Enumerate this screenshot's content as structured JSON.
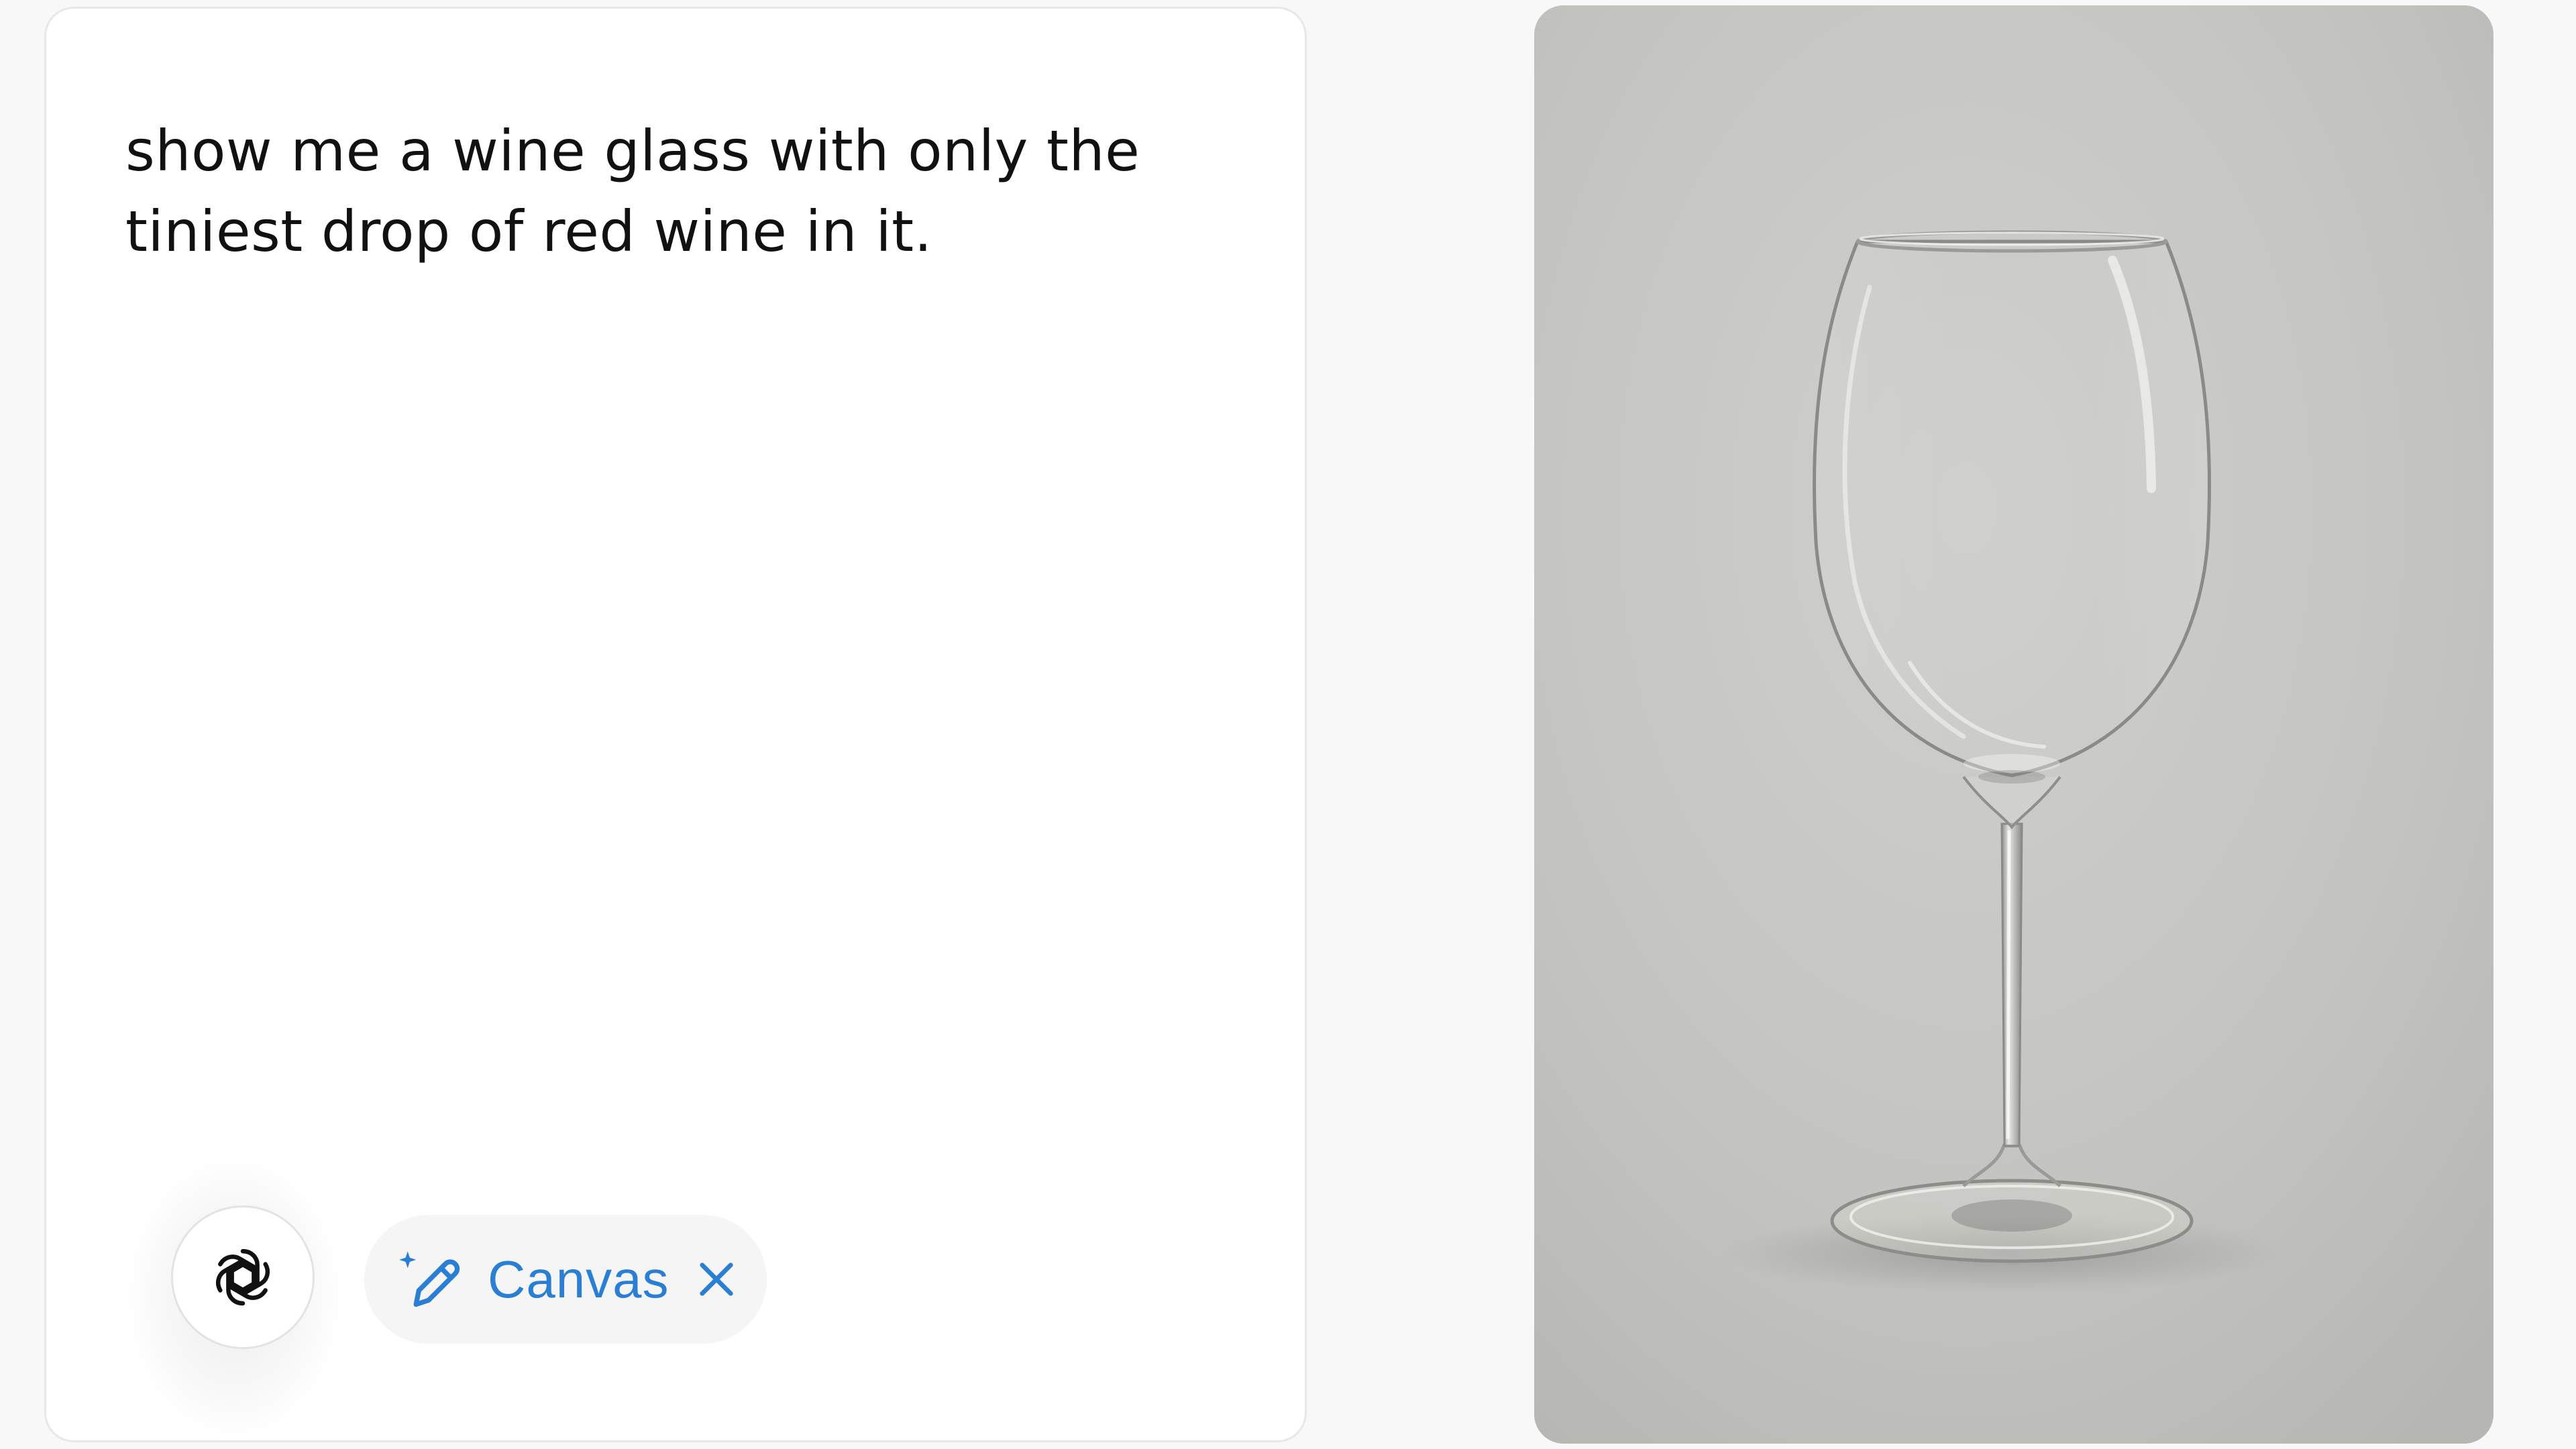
{
  "prompt": {
    "text": "show me a wine glass with only the tiniest drop of red wine in it."
  },
  "composer": {
    "avatar_icon": "openai-logo-icon",
    "tool_chip": {
      "label": "Canvas",
      "icon": "pencil-sparkle-icon",
      "close_icon": "close-icon"
    },
    "accent_color": "#2a7fd4"
  },
  "generated_image": {
    "subject": "empty-wine-glass",
    "background_color": "#c4c4c0"
  }
}
